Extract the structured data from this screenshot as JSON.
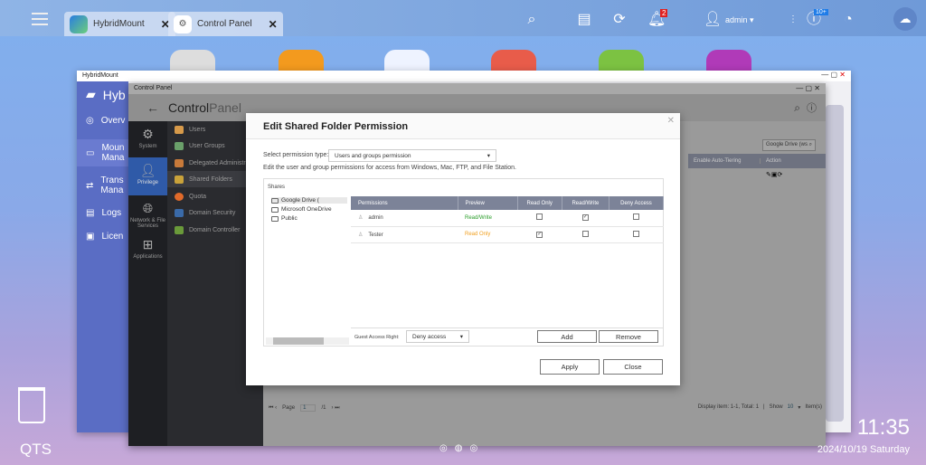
{
  "taskbar": {
    "tabs": [
      {
        "label": "HybridMount"
      },
      {
        "label": "Control Panel"
      }
    ],
    "user": "admin",
    "notification_count": "2",
    "update_count": "10+"
  },
  "hybridmount": {
    "title": "HybridMount",
    "app_name": "Hyb",
    "sidebar": [
      {
        "label": "Overv"
      },
      {
        "label": "Moun Mana"
      },
      {
        "label": "Trans Mana"
      },
      {
        "label": "Logs"
      },
      {
        "label": "Licen"
      }
    ]
  },
  "control_panel": {
    "title": "Control Panel",
    "header_a": "Control",
    "header_b": "Panel",
    "nav": [
      {
        "label": "System"
      },
      {
        "label": "Privilege"
      },
      {
        "label": "Network & File Services"
      },
      {
        "label": "Applications"
      }
    ],
    "menu": [
      {
        "label": "Users"
      },
      {
        "label": "User Groups"
      },
      {
        "label": "Delegated Administrat"
      },
      {
        "label": "Shared Folders"
      },
      {
        "label": "Quota"
      },
      {
        "label": "Domain Security"
      },
      {
        "label": "Domain Controller"
      }
    ],
    "search_value": "Google Drive (ws",
    "columns": [
      "Enable Auto-Tiering",
      "Action"
    ],
    "pager": {
      "page_label": "Page",
      "page": "1",
      "of": "/1",
      "display": "Display item: 1-1, Total: 1",
      "show_label": "Show",
      "show_value": "10",
      "items_label": "Item(s)"
    }
  },
  "dialog": {
    "title": "Edit Shared Folder Permission",
    "type_label": "Select permission type:",
    "type_value": "Users and groups permission",
    "description": "Edit the user and group permissions for access from Windows, Mac, FTP, and File Station.",
    "shares_label": "Shares",
    "shares": [
      "Google Drive (",
      "Microsoft OneDrive",
      "Public"
    ],
    "columns": [
      "Permissions",
      "Preview",
      "Read Only",
      "Read/Write",
      "Deny Access"
    ],
    "rows": [
      {
        "name": "admin",
        "preview": "Read/Write",
        "preview_color": "#2a9d2a",
        "ro": false,
        "rw": true,
        "deny": false
      },
      {
        "name": "Tester",
        "preview": "Read Only",
        "preview_color": "#f0a020",
        "ro": true,
        "rw": false,
        "deny": false
      }
    ],
    "guest_label": "Guest Access Right:",
    "guest_value": "Deny access",
    "add": "Add",
    "remove": "Remove",
    "apply": "Apply",
    "close": "Close"
  },
  "desktop": {
    "os_label": "QTS",
    "time": "11:35",
    "date": "2024/10/19 Saturday"
  }
}
